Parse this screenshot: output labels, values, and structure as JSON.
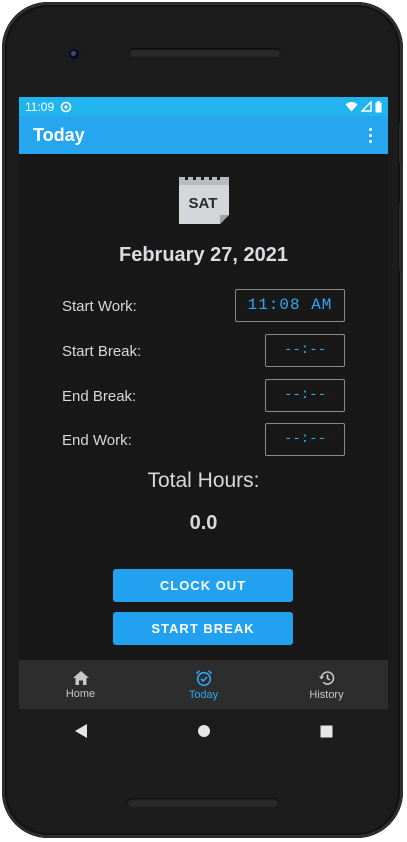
{
  "status_bar": {
    "time": "11:09"
  },
  "app_bar": {
    "title": "Today"
  },
  "calendar_icon": {
    "day": "SAT"
  },
  "date": "February 27, 2021",
  "rows": [
    {
      "label": "Start Work:",
      "value": "11:08 AM"
    },
    {
      "label": "Start Break:",
      "value": "--:--"
    },
    {
      "label": "End Break:",
      "value": "--:--"
    },
    {
      "label": "End Work:",
      "value": "--:--"
    }
  ],
  "total": {
    "label": "Total Hours:",
    "value": "0.0"
  },
  "buttons": {
    "clock_out": "CLOCK OUT",
    "start_break": "START BREAK"
  },
  "bottom_nav": [
    {
      "label": "Home",
      "icon": "home-icon",
      "active": false
    },
    {
      "label": "Today",
      "icon": "alarm-clock-icon",
      "active": true
    },
    {
      "label": "History",
      "icon": "history-icon",
      "active": false
    }
  ],
  "colors": {
    "accent": "#25a6ef",
    "status_bar": "#21b5f0",
    "background": "#181818",
    "nav_bg": "#2d2d2d",
    "time_text": "#2fa8f5"
  }
}
